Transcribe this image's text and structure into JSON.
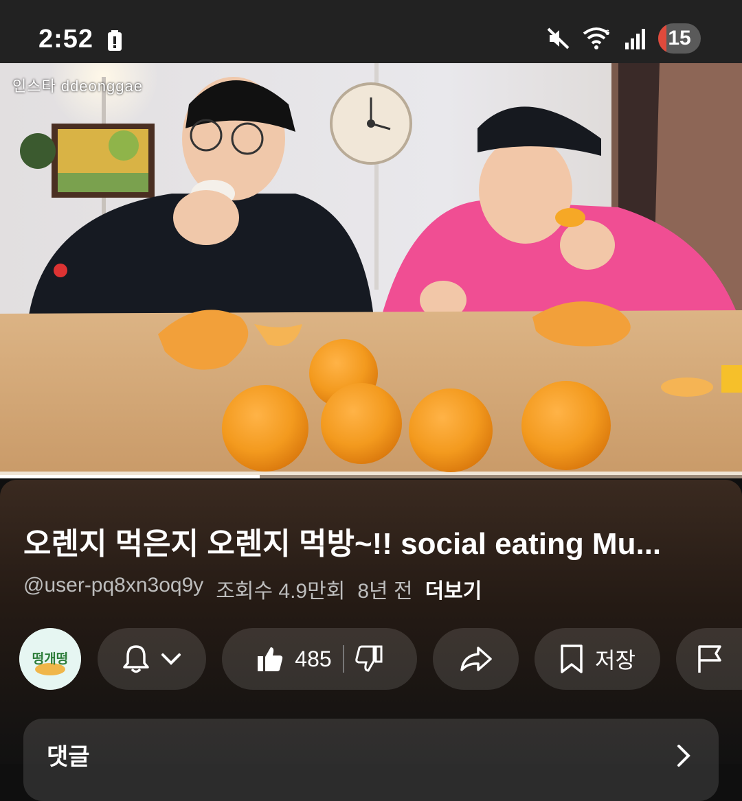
{
  "status_bar": {
    "time": "2:52",
    "notification_count": "15"
  },
  "video": {
    "watermark": "인스타 ddeonggae",
    "progress": 0.35
  },
  "title": "오렌지 먹은지 오렌지 먹방~!! social eating Mu...",
  "meta": {
    "channel": "@user-pq8xn3oq9y",
    "views": "조회수 4.9만회",
    "age": "8년 전",
    "more": "더보기"
  },
  "actions": {
    "avatar_text": "떵개떵",
    "like_count": "485",
    "save_label": "저장"
  },
  "comments": {
    "label": "댓글"
  },
  "colors": {
    "accent_red": "#e04a3c",
    "orange": "#f39a1e"
  }
}
